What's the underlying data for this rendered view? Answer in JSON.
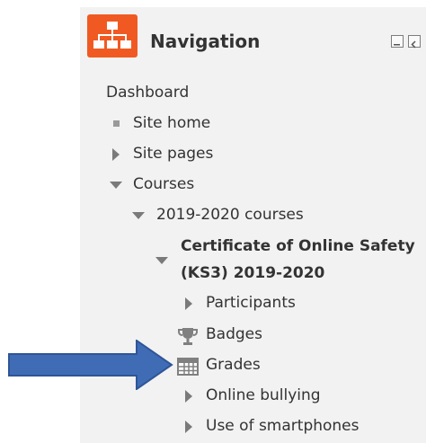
{
  "block": {
    "title": "Navigation",
    "icon": "sitemap-icon",
    "accent": "#f05a22",
    "controls": [
      "dock-icon",
      "hide-block-icon"
    ]
  },
  "nav": {
    "dashboard": "Dashboard",
    "site_home": "Site home",
    "site_pages": "Site pages",
    "courses": "Courses",
    "category": "2019-2020 courses",
    "course_line1": "Certificate of Online Safety",
    "course_line2": "(KS3) 2019-2020",
    "participants": "Participants",
    "badges": "Badges",
    "grades": "Grades",
    "online_bullying": "Online bullying",
    "smartphones": "Use of smartphones"
  },
  "annotation": {
    "arrow_color": "#3f6cb5",
    "points_to": "Grades"
  }
}
